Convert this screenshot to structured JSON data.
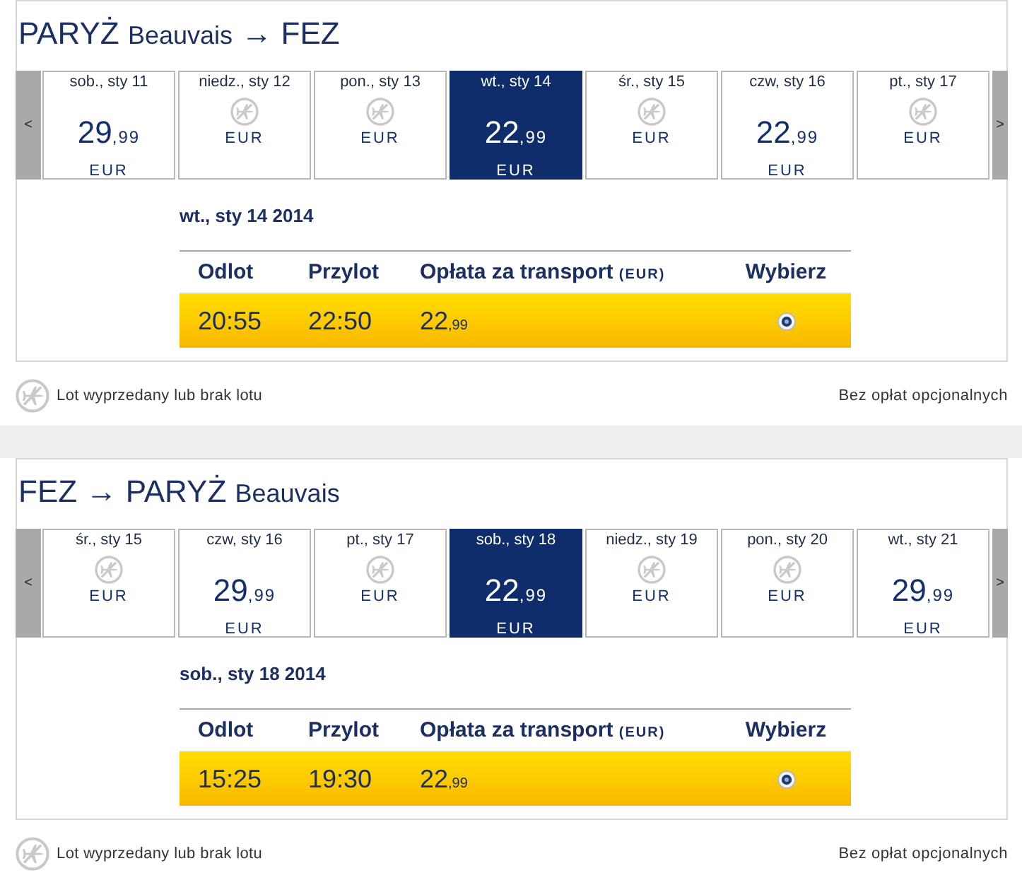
{
  "sections": [
    {
      "title": [
        {
          "kind": "city",
          "text": "PARYŻ"
        },
        {
          "kind": "airport",
          "text": "Beauvais"
        },
        {
          "kind": "arrow",
          "text": "→"
        },
        {
          "kind": "city",
          "text": "FEZ"
        }
      ],
      "prev_button": "<",
      "next_button": ">",
      "days": [
        {
          "label": "sob., sty 11",
          "available": true,
          "price": "29",
          "price_decimals": ",99",
          "currency": "EUR",
          "selected": false
        },
        {
          "label": "niedz., sty 12",
          "available": false,
          "currency": "EUR",
          "selected": false
        },
        {
          "label": "pon., sty 13",
          "available": false,
          "currency": "EUR",
          "selected": false
        },
        {
          "label": "wt., sty 14",
          "available": true,
          "price": "22",
          "price_decimals": ",99",
          "currency": "EUR",
          "selected": true
        },
        {
          "label": "śr., sty 15",
          "available": false,
          "currency": "EUR",
          "selected": false
        },
        {
          "label": "czw, sty 16",
          "available": true,
          "price": "22",
          "price_decimals": ",99",
          "currency": "EUR",
          "selected": false
        },
        {
          "label": "pt., sty 17",
          "available": false,
          "currency": "EUR",
          "selected": false
        }
      ],
      "selected_date": "wt., sty 14 2014",
      "columns": [
        {
          "label": "Odlot"
        },
        {
          "label": "Przylot"
        },
        {
          "label": "Opłata za transport",
          "unit": "(EUR)"
        },
        {
          "label": "Wybierz"
        }
      ],
      "flights": [
        {
          "departure": "20:55",
          "arrival": "22:50",
          "price": "22",
          "price_decimals": ",99",
          "selected": true
        }
      ],
      "legend": "Lot wyprzedany lub brak lotu",
      "fees_note": "Bez opłat opcjonalnych"
    },
    {
      "title": [
        {
          "kind": "city",
          "text": "FEZ"
        },
        {
          "kind": "arrow",
          "text": "→"
        },
        {
          "kind": "city",
          "text": "PARYŻ"
        },
        {
          "kind": "airport",
          "text": "Beauvais"
        }
      ],
      "prev_button": "<",
      "next_button": ">",
      "days": [
        {
          "label": "śr., sty 15",
          "available": false,
          "currency": "EUR",
          "selected": false
        },
        {
          "label": "czw, sty 16",
          "available": true,
          "price": "29",
          "price_decimals": ",99",
          "currency": "EUR",
          "selected": false
        },
        {
          "label": "pt., sty 17",
          "available": false,
          "currency": "EUR",
          "selected": false
        },
        {
          "label": "sob., sty 18",
          "available": true,
          "price": "22",
          "price_decimals": ",99",
          "currency": "EUR",
          "selected": true
        },
        {
          "label": "niedz., sty 19",
          "available": false,
          "currency": "EUR",
          "selected": false
        },
        {
          "label": "pon., sty 20",
          "available": false,
          "currency": "EUR",
          "selected": false
        },
        {
          "label": "wt., sty 21",
          "available": true,
          "price": "29",
          "price_decimals": ",99",
          "currency": "EUR",
          "selected": false
        }
      ],
      "selected_date": "sob., sty 18 2014",
      "columns": [
        {
          "label": "Odlot"
        },
        {
          "label": "Przylot"
        },
        {
          "label": "Opłata za transport",
          "unit": "(EUR)"
        },
        {
          "label": "Wybierz"
        }
      ],
      "flights": [
        {
          "departure": "15:25",
          "arrival": "19:30",
          "price": "22",
          "price_decimals": ",99",
          "selected": true
        }
      ],
      "legend": "Lot wyprzedany lub brak lotu",
      "fees_note": "Bez opłat opcjonalnych"
    }
  ]
}
